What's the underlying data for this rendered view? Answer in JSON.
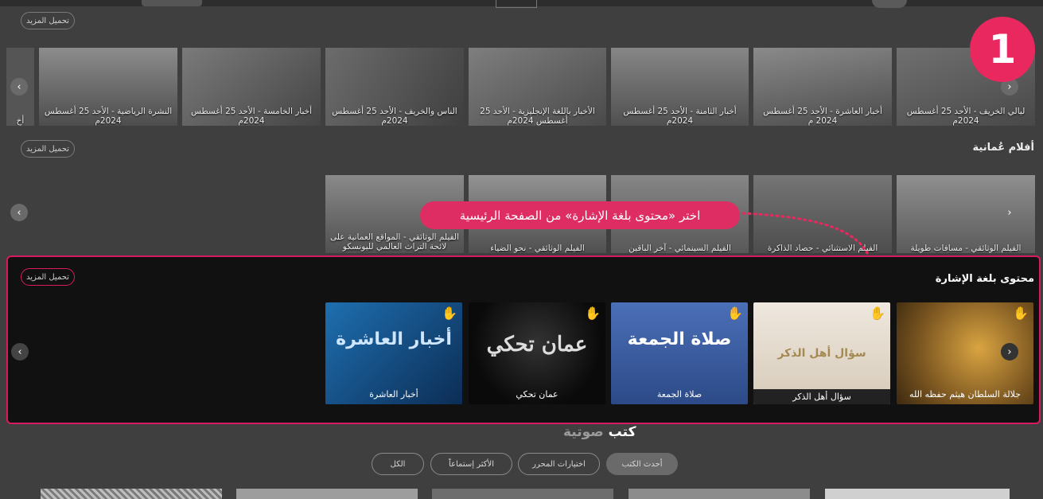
{
  "step_number": "1",
  "tooltip_text": "اختر «محتوى بلغة الإشارة» من الصفحة الرئيسية",
  "load_more_label": "تحميل المزيد",
  "news_row": {
    "items": [
      "ليالي الخريف - الأحد 25 أغسطس 2024م",
      "أخبار العاشرة - الأحد 25 أغسطس 2024 م",
      "أخبار الثامنة - الأحد 25 أغسطس 2024م",
      "الأخبار باللغة الإنجليزية - الأحد 25 أغسطس 2024م",
      "الناس والخريف - الأحد 25 أغسطس 2024م",
      "أخبار الخامسة - الأحد 25 أغسطس 2024م",
      "النشرة الرياضية - الأحد 25 أغسطس 2024م",
      "أخ"
    ]
  },
  "films_row": {
    "title": "أفلام عُمانية",
    "items": [
      "الفيلم الوثائقي - مسافات طويلة",
      "الفيلم الاستثنائي - حصاد الذاكرة",
      "الفيلم السينمائي - آخر الباقين",
      "الفيلم الوثائقي - نحو الضياء",
      "الفيلم الوثائقي - المواقع العمانية على لائحة التراث العالمي لليونسكو"
    ]
  },
  "sign_row": {
    "title": "محتوى بلغة الإشارة",
    "items": [
      {
        "caption": "جلالة السلطان هيثم حفظه الله",
        "art": ""
      },
      {
        "caption": "سؤال أهل الذكر",
        "art": "سؤال أهل الذكر"
      },
      {
        "caption": "صلاة الجمعة",
        "art": "صلاة الجمعة"
      },
      {
        "caption": "عمان تحكي",
        "art": "عمان تحكي"
      },
      {
        "caption": "أخبار العاشرة",
        "art": "أخبار العاشرة"
      }
    ]
  },
  "audio_books": {
    "title_part1": "كتب",
    "title_part2": "صوتية",
    "filters": [
      "أحدث الكتب",
      "اختيارات المحرر",
      "الأكثر إستماعاً",
      "الكل"
    ]
  },
  "icons": {
    "prev": "chevron-left-icon",
    "next": "chevron-right-icon",
    "sign": "sign-language-hand-icon"
  },
  "colors": {
    "accent": "#e8285f",
    "panel_border": "#d81b60"
  }
}
